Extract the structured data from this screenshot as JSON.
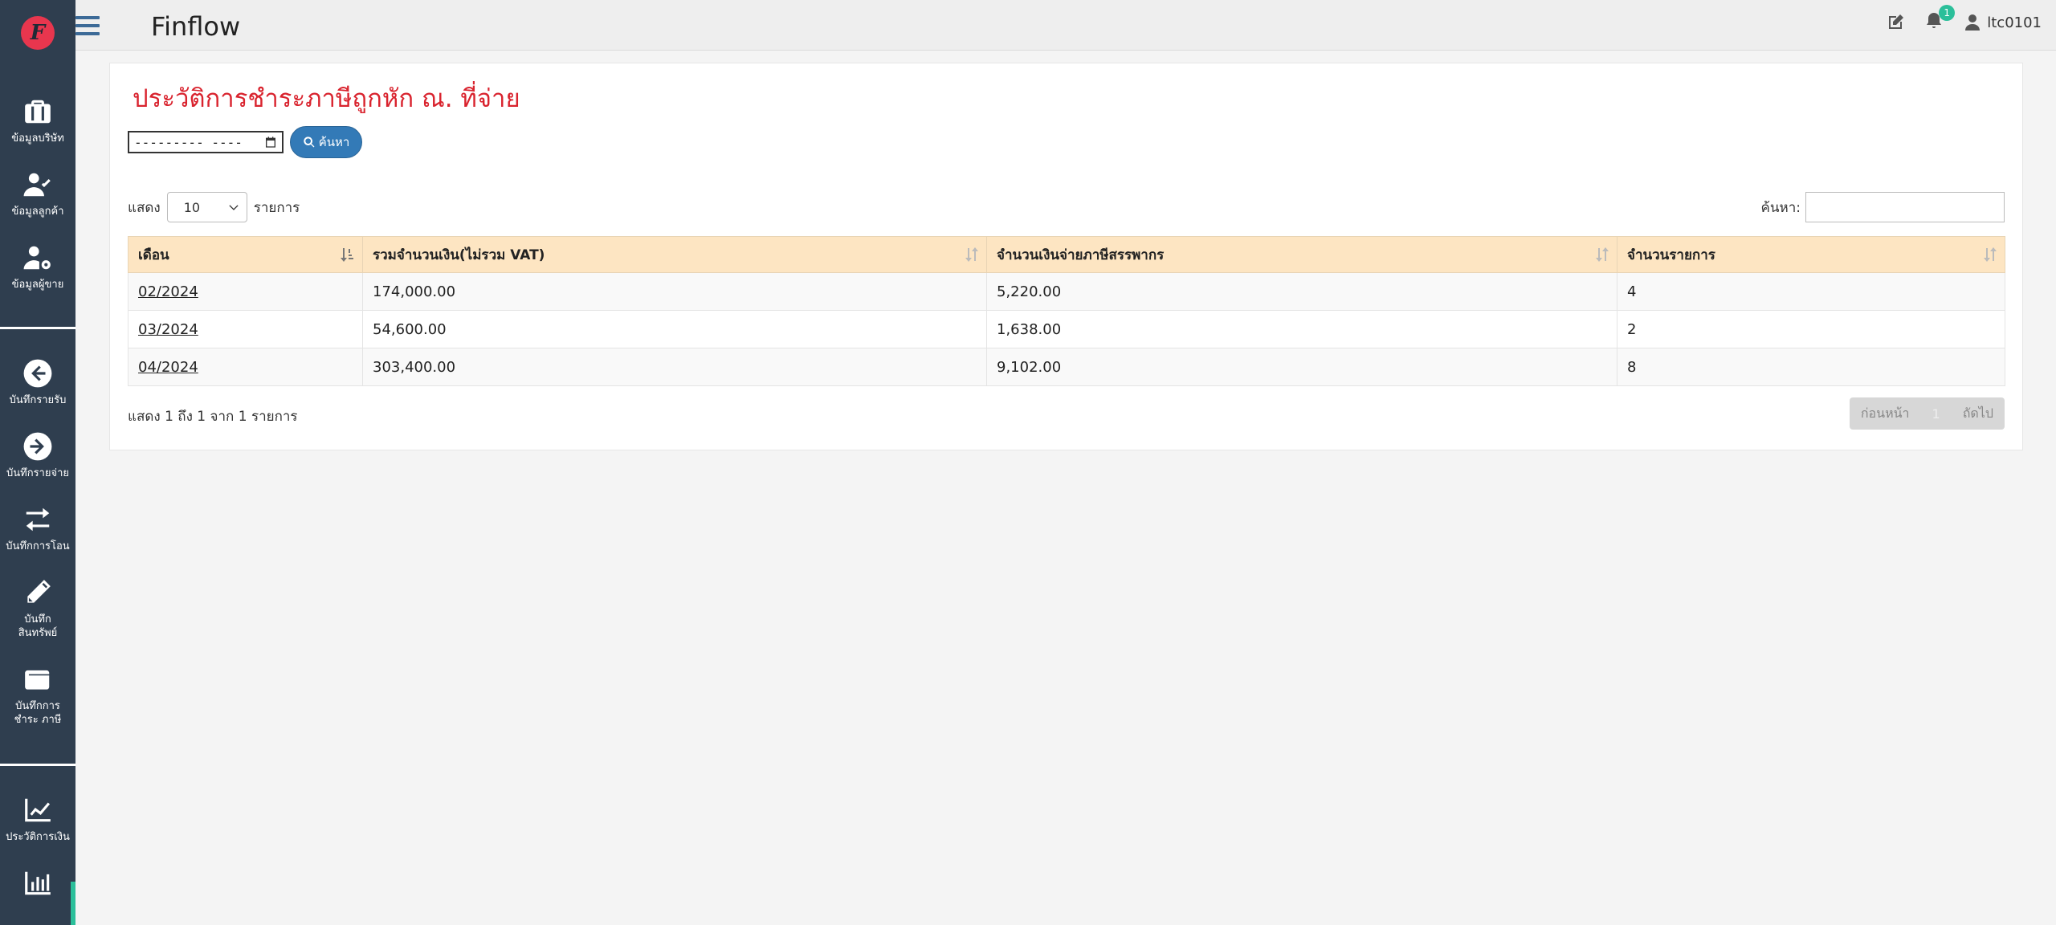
{
  "app": {
    "title": "Finflow",
    "logo_letter": "F"
  },
  "topbar": {
    "notification_count": "1",
    "username": "ltc0101"
  },
  "sidebar": {
    "items": [
      {
        "label": "ข้อมูลบริษัท",
        "icon": "briefcase-icon"
      },
      {
        "label": "ข้อมูลลูกค้า",
        "icon": "user-check-icon"
      },
      {
        "label": "ข้อมูลผู้ขาย",
        "icon": "user-gear-icon"
      },
      {
        "label": "บันทึกรายรับ",
        "icon": "arrow-left-circle-icon"
      },
      {
        "label": "บันทึกรายจ่าย",
        "icon": "arrow-right-circle-icon"
      },
      {
        "label": "บันทึกการโอน",
        "icon": "transfer-icon"
      },
      {
        "label": "บันทึก สินทรัพย์",
        "icon": "pencil-icon"
      },
      {
        "label": "บันทึกการชำระ ภาษี",
        "icon": "wallet-icon"
      },
      {
        "label": "ประวัติการเงิน",
        "icon": "line-chart-icon"
      },
      {
        "label": "",
        "icon": "bar-chart-icon"
      }
    ]
  },
  "page": {
    "title": "ประวัติการชำระภาษีถูกหัก ณ. ที่จ่าย",
    "date_value": "---------  ----",
    "search_button": "ค้นหา"
  },
  "table_controls": {
    "show_label": "แสดง",
    "page_size": "10",
    "entries_label": "รายการ",
    "search_label": "ค้นหา:"
  },
  "table": {
    "columns": [
      "เดือน",
      "รวมจำนวนเงิน(ไม่รวม VAT)",
      "จำนวนเงินจ่ายภาษีสรรพากร",
      "จำนวนรายการ"
    ],
    "rows": [
      [
        "02/2024",
        "174,000.00",
        "5,220.00",
        "4"
      ],
      [
        "03/2024",
        "54,600.00",
        "1,638.00",
        "2"
      ],
      [
        "04/2024",
        "303,400.00",
        "9,102.00",
        "8"
      ]
    ]
  },
  "footer": {
    "info": "แสดง 1 ถึง 1 จาก 1 รายการ",
    "prev": "ก่อนหน้า",
    "current_page": "1",
    "next": "ถัดไป"
  },
  "colors": {
    "sidebar": "#2f3e4f",
    "title_red": "#d9232e",
    "header_bg": "#fde5c2",
    "accent_teal": "#2bbf9a",
    "button_blue": "#337ab7"
  }
}
